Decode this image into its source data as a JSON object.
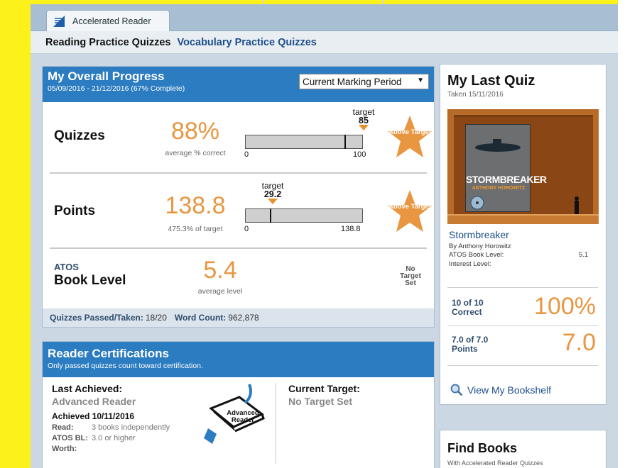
{
  "tab": {
    "label": "Accelerated Reader"
  },
  "subnav": {
    "active": "Reading Practice Quizzes",
    "link": "Vocabulary Practice Quizzes"
  },
  "progress": {
    "title": "My Overall Progress",
    "dates": "05/09/2016 - 21/12/2016 (67% Complete)",
    "period": "Current Marking Period",
    "quizzes": {
      "label": "Quizzes",
      "value": "88%",
      "caption": "average % correct",
      "target_label": "target",
      "target_value": "85",
      "bar_min": "0",
      "bar_max": "100",
      "fill_fraction": 0.85,
      "badge": "Above Target"
    },
    "points": {
      "label": "Points",
      "value": "138.8",
      "caption": "475.3% of target",
      "target_label": "target",
      "target_value": "29.2",
      "bar_min": "0",
      "bar_max": "138.8",
      "fill_fraction": 0.21,
      "badge": "Above Target"
    },
    "atos": {
      "label_small": "ATOS",
      "label": "Book Level",
      "value": "5.4",
      "caption": "average level",
      "no_target": "No Target Set"
    },
    "footer": {
      "quizzes_label": "Quizzes Passed/Taken:",
      "quizzes_value": "18/20",
      "words_label": "Word Count:",
      "words_value": "962,878"
    }
  },
  "certifications": {
    "title": "Reader Certifications",
    "subtitle": "Only passed quizzes count toward certification.",
    "last_label": "Last Achieved:",
    "last_value": "Advanced Reader",
    "achieved": "Achieved 10/11/2016",
    "read_label": "Read:",
    "read_value": "3 books independently",
    "atos_label": "ATOS BL:",
    "atos_value": "3.0 or higher",
    "worth_label": "Worth:",
    "badge_text": "Advanced Reader",
    "current_label": "Current Target:",
    "current_value": "No Target Set"
  },
  "last_quiz": {
    "title": "My Last Quiz",
    "taken": "Taken 15/11/2016",
    "book_cover_title": "STORMBREAKER",
    "book_cover_author": "ANTHONY HOROWITZ",
    "book_title": "Stormbreaker",
    "author": "By Anthony Horowitz",
    "atos_label": "ATOS Book Level:",
    "atos_value": "5.1",
    "interest_label": "Interest Level:",
    "correct_label": "10 of 10 Correct",
    "correct_value": "100%",
    "points_label": "7.0 of 7.0 Points",
    "points_value": "7.0",
    "bookshelf": "View My Bookshelf"
  },
  "find_books": {
    "title": "Find Books",
    "subtitle": "With Accelerated Reader Quizzes"
  },
  "colors": {
    "header_blue": "#2c7cc1",
    "accent_orange": "#e89640",
    "link_blue": "#1d4f8c"
  }
}
